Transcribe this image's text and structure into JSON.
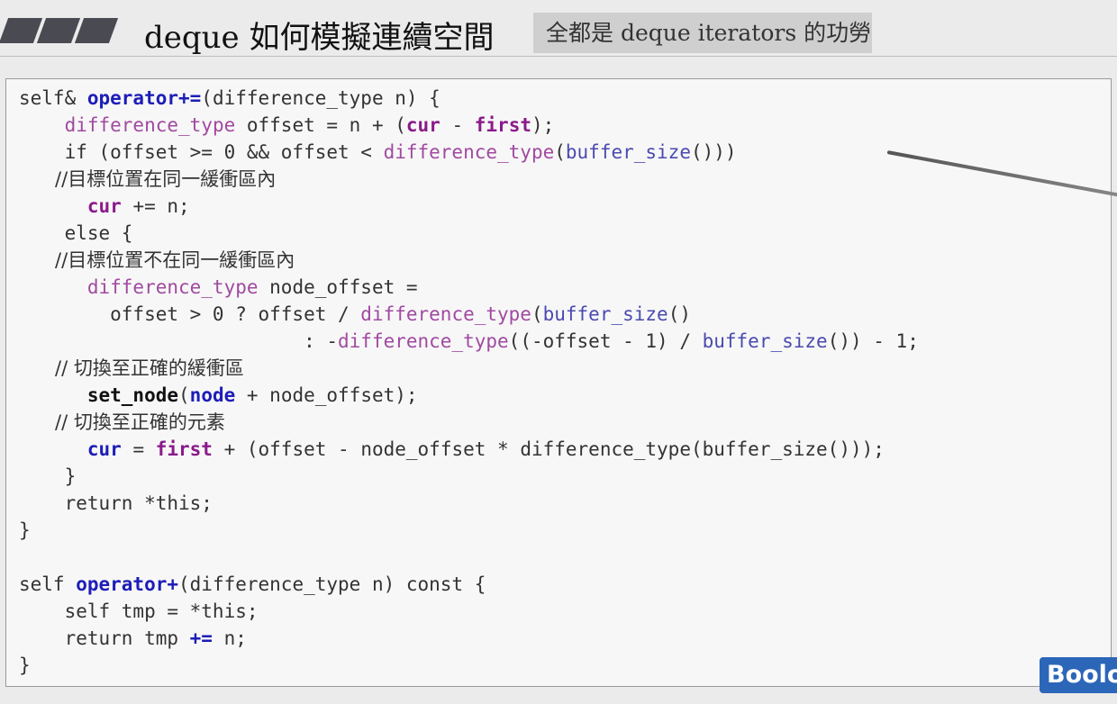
{
  "header": {
    "title": "deque 如何模擬連續空間",
    "subtitle": "全都是 deque iterators 的功勞"
  },
  "code": {
    "l1": {
      "a": "self& ",
      "b": "operator+=",
      "c": "(difference_type n) {"
    },
    "l2": {
      "a": "    ",
      "b": "difference_type",
      "c": " offset = n + (",
      "d": "cur",
      "e": " - ",
      "f": "first",
      "g": ");"
    },
    "l3": {
      "a": "    if (offset >= 0 && offset < ",
      "b": "difference_type",
      "c": "(",
      "d": "buffer_size",
      "e": "()))"
    },
    "l4": {
      "a": "      //目標位置在同一緩衝區內"
    },
    "l5": {
      "a": "      ",
      "b": "cur",
      "c": " += n;"
    },
    "l6": {
      "a": "    else {"
    },
    "l7": {
      "a": "      //目標位置不在同一緩衝區內"
    },
    "l8": {
      "a": "      ",
      "b": "difference_type",
      "c": " node_offset ="
    },
    "l9": {
      "a": "        offset > 0 ? offset / ",
      "b": "difference_type",
      "c": "(",
      "d": "buffer_size",
      "e": "()"
    },
    "l10": {
      "a": "                         : -",
      "b": "difference_type",
      "c": "((-offset - 1) / ",
      "d": "buffer_size",
      "e": "()) - 1;"
    },
    "l11": {
      "a": "      // 切換至正確的緩衝區"
    },
    "l12": {
      "a": "      ",
      "b": "set_node",
      "c": "(",
      "d": "node",
      "e": " + node_offset);"
    },
    "l13": {
      "a": "      // 切換至正確的元素"
    },
    "l14": {
      "a": "      ",
      "b": "cur",
      "c": " = ",
      "d": "first",
      "e": " + (offset - node_offset * difference_type(buffer_size()));"
    },
    "l15": {
      "a": "    }"
    },
    "l16": {
      "a": "    return *this;"
    },
    "l17": {
      "a": "}"
    },
    "l18": {
      "a": "self ",
      "b": "operator+",
      "c": "(difference_type n) const {"
    },
    "l19": {
      "a": "    self tmp = *this;"
    },
    "l20": {
      "a": "    return tmp ",
      "b": "+=",
      "c": " n;"
    },
    "l21": {
      "a": "}"
    }
  },
  "watermark": {
    "logo_text": "Boolo"
  }
}
